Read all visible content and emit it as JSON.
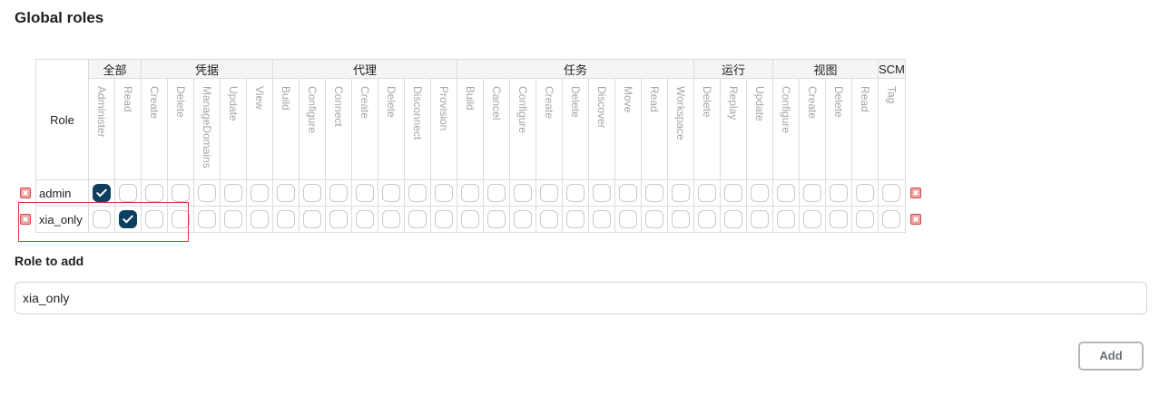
{
  "title": "Global roles",
  "table": {
    "role_header": "Role",
    "groups": [
      {
        "name": "全部",
        "perms": [
          "Administer",
          "Read"
        ]
      },
      {
        "name": "凭据",
        "perms": [
          "Create",
          "Delete",
          "ManageDomains",
          "Update",
          "View"
        ]
      },
      {
        "name": "代理",
        "perms": [
          "Build",
          "Configure",
          "Connect",
          "Create",
          "Delete",
          "Disconnect",
          "Provision"
        ]
      },
      {
        "name": "任务",
        "perms": [
          "Build",
          "Cancel",
          "Configure",
          "Create",
          "Delete",
          "Discover",
          "Move",
          "Read",
          "Workspace"
        ]
      },
      {
        "name": "运行",
        "perms": [
          "Delete",
          "Replay",
          "Update"
        ]
      },
      {
        "name": "视图",
        "perms": [
          "Configure",
          "Create",
          "Delete",
          "Read"
        ]
      },
      {
        "name": "SCM",
        "perms": [
          "Tag"
        ]
      }
    ],
    "rows": [
      {
        "name": "admin",
        "checked": [
          0
        ]
      },
      {
        "name": "xia_only",
        "checked": [
          1
        ]
      }
    ]
  },
  "role_to_add": {
    "label": "Role to add",
    "value": "xia_only"
  },
  "add_button": "Add",
  "colors": {
    "checked": "#0d3f60",
    "highlight": "#d43a3a",
    "delete_icon": "#d74a4a"
  }
}
